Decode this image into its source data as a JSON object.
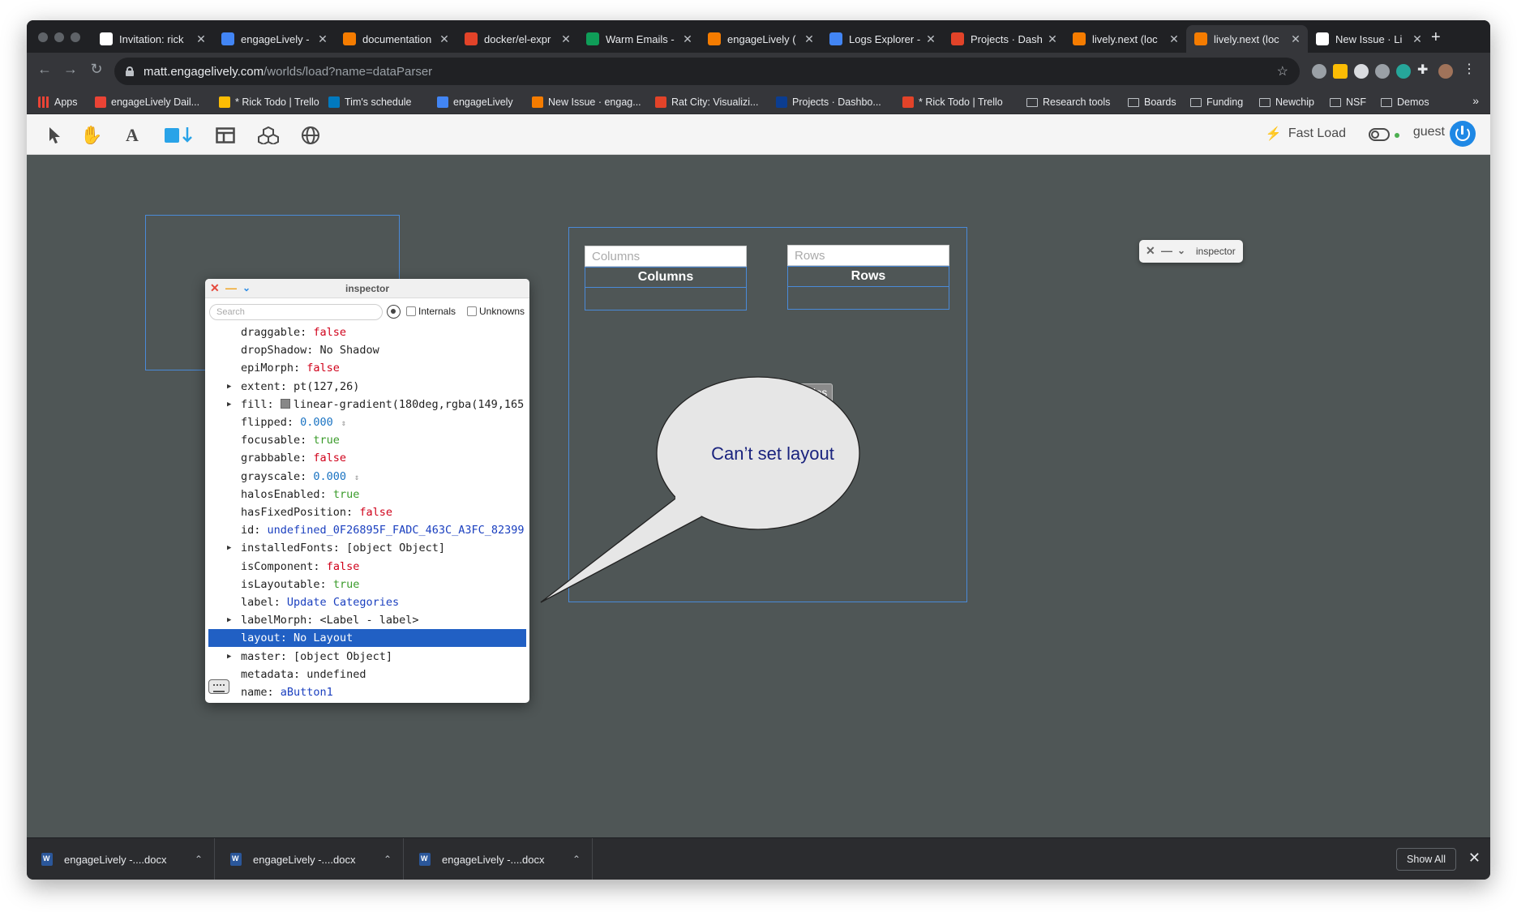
{
  "browser": {
    "tabs": [
      {
        "title": "Invitation: rick",
        "color": "#ffffff"
      },
      {
        "title": "engageLively -",
        "color": "#4285f4"
      },
      {
        "title": "documentation",
        "color": "#f57c00"
      },
      {
        "title": "docker/el-expr",
        "color": "#e24329"
      },
      {
        "title": "Warm Emails -",
        "color": "#0f9d58"
      },
      {
        "title": "engageLively (",
        "color": "#f57c00"
      },
      {
        "title": "Logs Explorer -",
        "color": "#4285f4"
      },
      {
        "title": "Projects · Dash",
        "color": "#e24329"
      },
      {
        "title": "lively.next (loc",
        "color": "#f57c00"
      },
      {
        "title": "lively.next (loc",
        "color": "#f57c00"
      },
      {
        "title": "New Issue · Li",
        "color": "#ffffff"
      }
    ],
    "new_tab": "+",
    "url_host": "matt.engagelively.com",
    "url_path": "/worlds/load?name=dataParser",
    "bookmarks": [
      {
        "label": "Apps",
        "kind": "apps"
      },
      {
        "label": "engageLively Dail...",
        "kind": "site"
      },
      {
        "label": "* Rick Todo | Trello",
        "kind": "site"
      },
      {
        "label": "Tim's schedule",
        "kind": "site"
      },
      {
        "label": "engageLively",
        "kind": "site"
      },
      {
        "label": "New Issue · engag...",
        "kind": "site"
      },
      {
        "label": "Rat City: Visualizi...",
        "kind": "site"
      },
      {
        "label": "Projects · Dashbo...",
        "kind": "site"
      },
      {
        "label": "* Rick Todo | Trello",
        "kind": "site"
      },
      {
        "label": "Research tools",
        "kind": "folder"
      },
      {
        "label": "Boards",
        "kind": "folder"
      },
      {
        "label": "Funding",
        "kind": "folder"
      },
      {
        "label": "Newchip",
        "kind": "folder"
      },
      {
        "label": "NSF",
        "kind": "folder"
      },
      {
        "label": "Demos",
        "kind": "folder"
      }
    ],
    "bookmarks_more": "»"
  },
  "lively": {
    "fast_load_label": "Fast Load",
    "user_label": "guest"
  },
  "inspector": {
    "title": "inspector",
    "search_placeholder": "Search",
    "internals_label": "Internals",
    "unknowns_label": "Unknowns",
    "rows": [
      {
        "key": "draggable:",
        "value": "false",
        "vclass": "v-false",
        "expandable": false
      },
      {
        "key": "dropShadow:",
        "value": "No Shadow",
        "vclass": "v-plain",
        "expandable": false
      },
      {
        "key": "epiMorph:",
        "value": "false",
        "vclass": "v-false",
        "expandable": false
      },
      {
        "key": "extent:",
        "value": "pt(127,26)",
        "vclass": "v-plain",
        "expandable": true
      },
      {
        "key": "fill:",
        "value": "linear-gradient(180deg,rgba(149,165",
        "vclass": "v-plain",
        "expandable": true,
        "swatch": true
      },
      {
        "key": "flipped:",
        "value": "0.000",
        "vclass": "v-num",
        "expandable": false,
        "spinner": true
      },
      {
        "key": "focusable:",
        "value": "true",
        "vclass": "v-true",
        "expandable": false
      },
      {
        "key": "grabbable:",
        "value": "false",
        "vclass": "v-false",
        "expandable": false
      },
      {
        "key": "grayscale:",
        "value": "0.000",
        "vclass": "v-num",
        "expandable": false,
        "spinner": true
      },
      {
        "key": "halosEnabled:",
        "value": "true",
        "vclass": "v-true",
        "expandable": false
      },
      {
        "key": "hasFixedPosition:",
        "value": "false",
        "vclass": "v-false",
        "expandable": false
      },
      {
        "key": "id:",
        "value": "undefined_0F26895F_FADC_463C_A3FC_82399",
        "vclass": "v-blue",
        "expandable": false
      },
      {
        "key": "installedFonts:",
        "value": "[object Object]",
        "vclass": "v-plain",
        "expandable": true
      },
      {
        "key": "isComponent:",
        "value": "false",
        "vclass": "v-false",
        "expandable": false
      },
      {
        "key": "isLayoutable:",
        "value": "true",
        "vclass": "v-true",
        "expandable": false
      },
      {
        "key": "label:",
        "value": "Update Categories",
        "vclass": "v-blue",
        "expandable": false
      },
      {
        "key": "labelMorph:",
        "value": "<Label - label>",
        "vclass": "v-plain",
        "expandable": true
      },
      {
        "key": "layout:",
        "value": "No Layout",
        "vclass": "v-plain",
        "expandable": false,
        "selected": true
      },
      {
        "key": "master:",
        "value": "[object Object]",
        "vclass": "v-plain",
        "expandable": true
      },
      {
        "key": "metadata:",
        "value": "undefined",
        "vclass": "v-plain",
        "expandable": false
      },
      {
        "key": "name:",
        "value": "aButton1",
        "vclass": "v-blue",
        "expandable": false
      }
    ]
  },
  "parser_panel": {
    "columns_placeholder": "Columns",
    "columns_header": "Columns",
    "rows_placeholder": "Rows",
    "rows_header": "Rows",
    "update_button": "Update Categories"
  },
  "speech_bubble": {
    "text": "Can’t set layout"
  },
  "mini_inspector": {
    "title": "inspector"
  },
  "downloads": {
    "items": [
      "engageLively -....docx",
      "engageLively -....docx",
      "engageLively -....docx"
    ],
    "show_all": "Show All"
  }
}
